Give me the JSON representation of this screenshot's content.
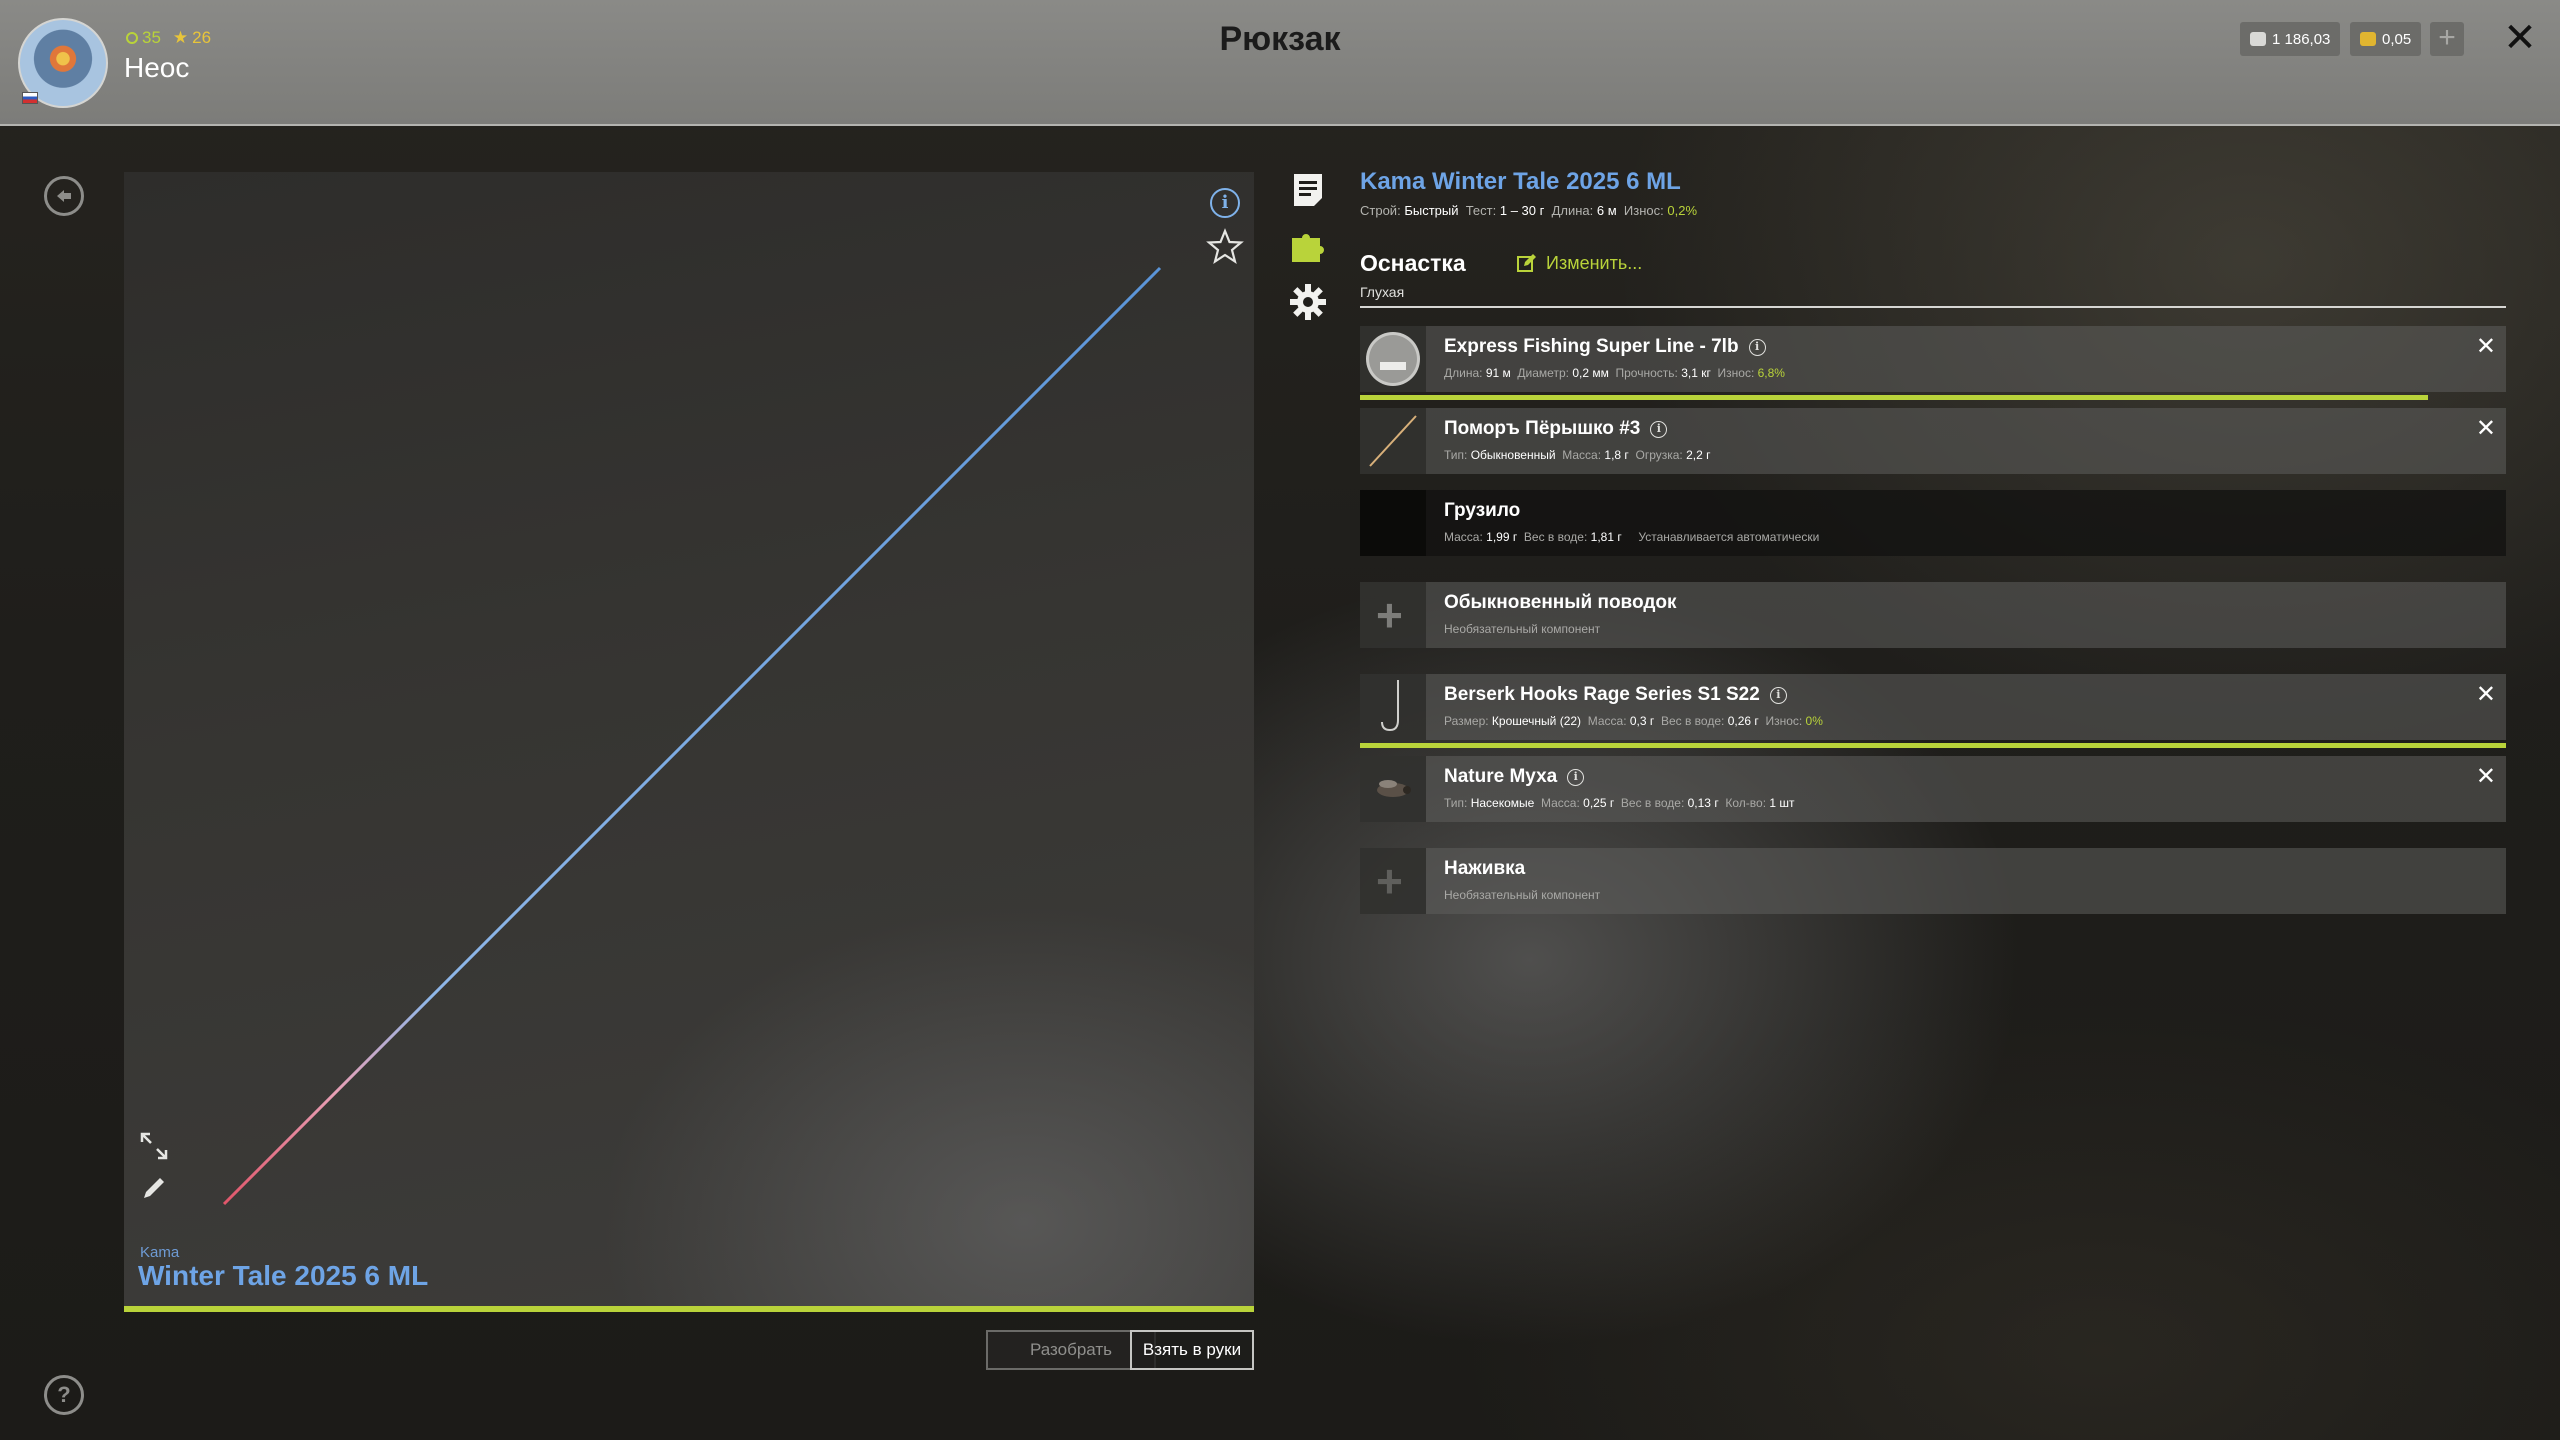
{
  "header": {
    "title": "Рюкзак",
    "player": {
      "name": "Неос",
      "level": "35",
      "fame": "26"
    },
    "currency": {
      "silver": "1 186,03",
      "gold": "0,05"
    },
    "add_label": "+",
    "close_label": "✕"
  },
  "rod": {
    "brand": "Kama",
    "model": "Winter Tale 2025 6 ML",
    "full_title": "Kama Winter Tale 2025 6 ML",
    "specs": {
      "action_label": "Строй:",
      "action_value": "Быстрый",
      "test_label": "Тест:",
      "test_value": "1 – 30 г",
      "length_label": "Длина:",
      "length_value": "6 м",
      "wear_label": "Износ:",
      "wear_value": "0,2%"
    },
    "wear_fraction": 0.998
  },
  "rig": {
    "label": "Оснастка",
    "type": "Глухая",
    "edit_label": "Изменить..."
  },
  "components": [
    {
      "name": "Express Fishing Super Line - 7lb",
      "details": [
        {
          "k": "Длина:",
          "v": "91 м"
        },
        {
          "k": "Диаметр:",
          "v": "0,2 мм"
        },
        {
          "k": "Прочность:",
          "v": "3,1 кг"
        },
        {
          "k": "Износ:",
          "v": "6,8%"
        }
      ],
      "wear_fraction": 0.932
    },
    {
      "name": "Поморъ Пёрышко #3",
      "details": [
        {
          "k": "Тип:",
          "v": "Обыкновенный"
        },
        {
          "k": "Масса:",
          "v": "1,8 г"
        },
        {
          "k": "Огрузка:",
          "v": "2,2 г"
        }
      ]
    },
    {
      "name": "Грузило",
      "details": [
        {
          "k": "Масса:",
          "v": "1,99 г"
        },
        {
          "k": "Вес в воде:",
          "v": "1,81 г"
        }
      ],
      "note": "Устанавливается автоматически"
    },
    {
      "name": "Обыкновенный поводок",
      "subtitle": "Необязательный компонент"
    },
    {
      "name": "Berserk Hooks Rage Series S1 S22",
      "details": [
        {
          "k": "Размер:",
          "v": "Крошечный (22)"
        },
        {
          "k": "Масса:",
          "v": "0,3 г"
        },
        {
          "k": "Вес в воде:",
          "v": "0,26 г"
        },
        {
          "k": "Износ:",
          "v": "0%"
        }
      ],
      "wear_fraction": 1.0
    },
    {
      "name": "Nature Муха",
      "details": [
        {
          "k": "Тип:",
          "v": "Насекомые"
        },
        {
          "k": "Масса:",
          "v": "0,25 г"
        },
        {
          "k": "Вес в воде:",
          "v": "0,13 г"
        },
        {
          "k": "Кол-во:",
          "v": "1 шт"
        }
      ]
    },
    {
      "name": "Наживка",
      "subtitle": "Необязательный компонент"
    }
  ],
  "buttons": {
    "disassemble": "Разобрать",
    "equip": "Взять в руки"
  },
  "colors": {
    "accent_green": "#b9d33a",
    "title_blue": "#6ea4e6",
    "header_bg": "#8a8a87"
  }
}
